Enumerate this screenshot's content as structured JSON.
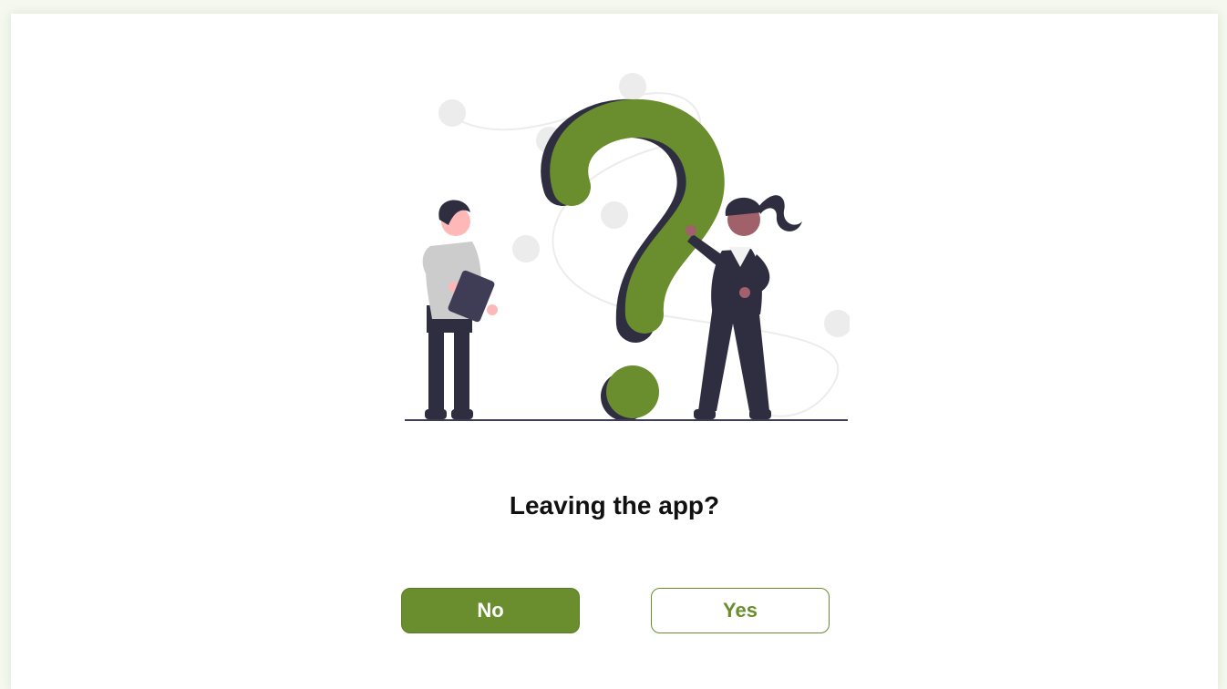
{
  "dialog": {
    "title": "Leaving the app?",
    "no_label": "No",
    "yes_label": "Yes"
  },
  "illustration": {
    "icon": "question-mark-people-illustration"
  },
  "colors": {
    "accent": "#6a8d2e",
    "dark": "#2f2e41",
    "light_gray": "#e6e6e6"
  }
}
